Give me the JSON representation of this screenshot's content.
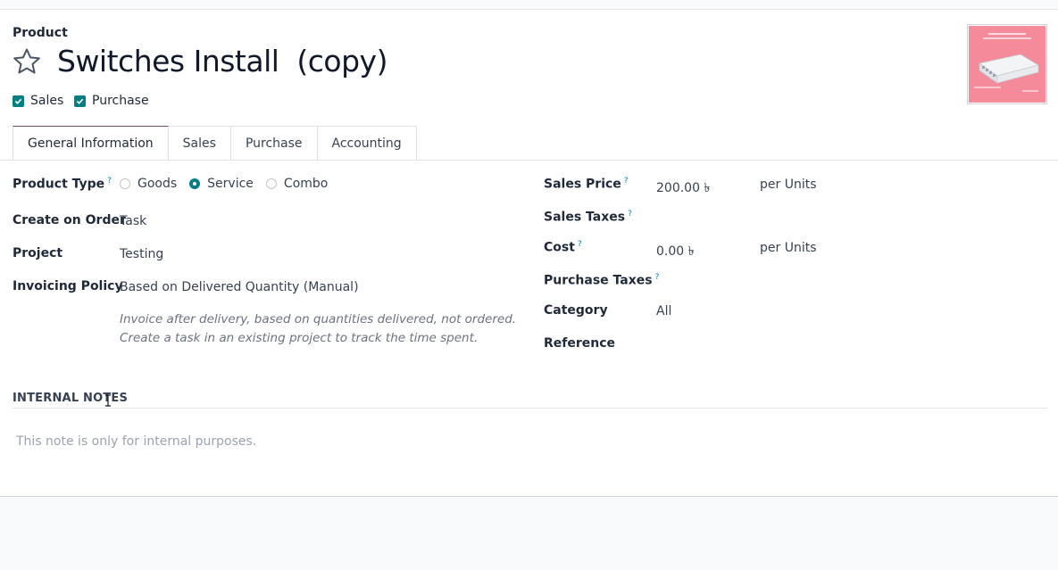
{
  "form": {
    "model_label": "Product",
    "product_name": "Switches Install  (copy)",
    "can_be_sold_label": "Sales",
    "can_be_purchased_label": "Purchase"
  },
  "tabs": [
    {
      "label": "General Information",
      "active": true
    },
    {
      "label": "Sales",
      "active": false
    },
    {
      "label": "Purchase",
      "active": false
    },
    {
      "label": "Accounting",
      "active": false
    }
  ],
  "left": {
    "product_type": {
      "label": "Product Type",
      "help": "?",
      "options": [
        "Goods",
        "Service",
        "Combo"
      ],
      "selected": "Service"
    },
    "create_on_order": {
      "label": "Create on Order",
      "value": "Task"
    },
    "project": {
      "label": "Project",
      "value": "Testing"
    },
    "invoicing_policy": {
      "label": "Invoicing Policy",
      "value": "Based on Delivered Quantity (Manual)",
      "help_text": "Invoice after delivery, based on quantities delivered, not ordered. Create a task in an existing project to track the time spent."
    }
  },
  "right": {
    "sales_price": {
      "label": "Sales Price",
      "help": "?",
      "value": "200.00 ৳",
      "uom": "per Units"
    },
    "sales_taxes": {
      "label": "Sales Taxes",
      "help": "?",
      "value": ""
    },
    "cost": {
      "label": "Cost",
      "help": "?",
      "value": "0.00 ৳",
      "uom": "per Units"
    },
    "purchase_taxes": {
      "label": "Purchase Taxes",
      "help": "?",
      "value": ""
    },
    "category": {
      "label": "Category",
      "value": "All"
    },
    "reference": {
      "label": "Reference",
      "value": ""
    }
  },
  "internal_notes": {
    "title": "INTERNAL NOTES",
    "placeholder": "This note is only for internal purposes."
  },
  "image": {
    "caption_top": "5-port Ethernet switch",
    "background": "#f48a9a"
  },
  "colors": {
    "accent": "#017e84",
    "tab_active": "#714b67",
    "help": "#0180a5"
  }
}
